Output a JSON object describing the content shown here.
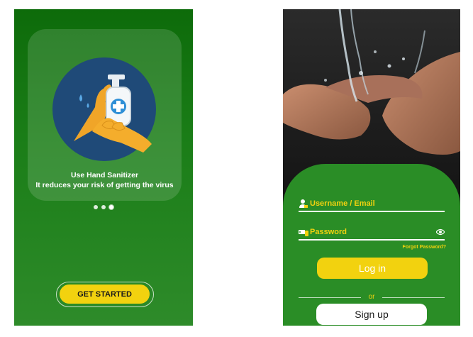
{
  "onboarding": {
    "slide_title": "Use Hand Sanitizer",
    "slide_subtitle": "It reduces your risk of getting the virus",
    "page_dots": 3,
    "get_started_label": "GET STARTED",
    "icons": [
      "hand-sanitizer-icon"
    ]
  },
  "login": {
    "username_placeholder": "Username / Email",
    "password_placeholder": "Password",
    "forgot_password": "Forgot Password?",
    "login_label": "Log in",
    "or_label": "or",
    "signup_label": "Sign up",
    "icons": [
      "user-icon",
      "key-icon",
      "eye-icon"
    ]
  },
  "colors": {
    "green_dark": "#0d6b0a",
    "green": "#2a8d26",
    "yellow": "#f2d20f",
    "white": "#ffffff"
  }
}
